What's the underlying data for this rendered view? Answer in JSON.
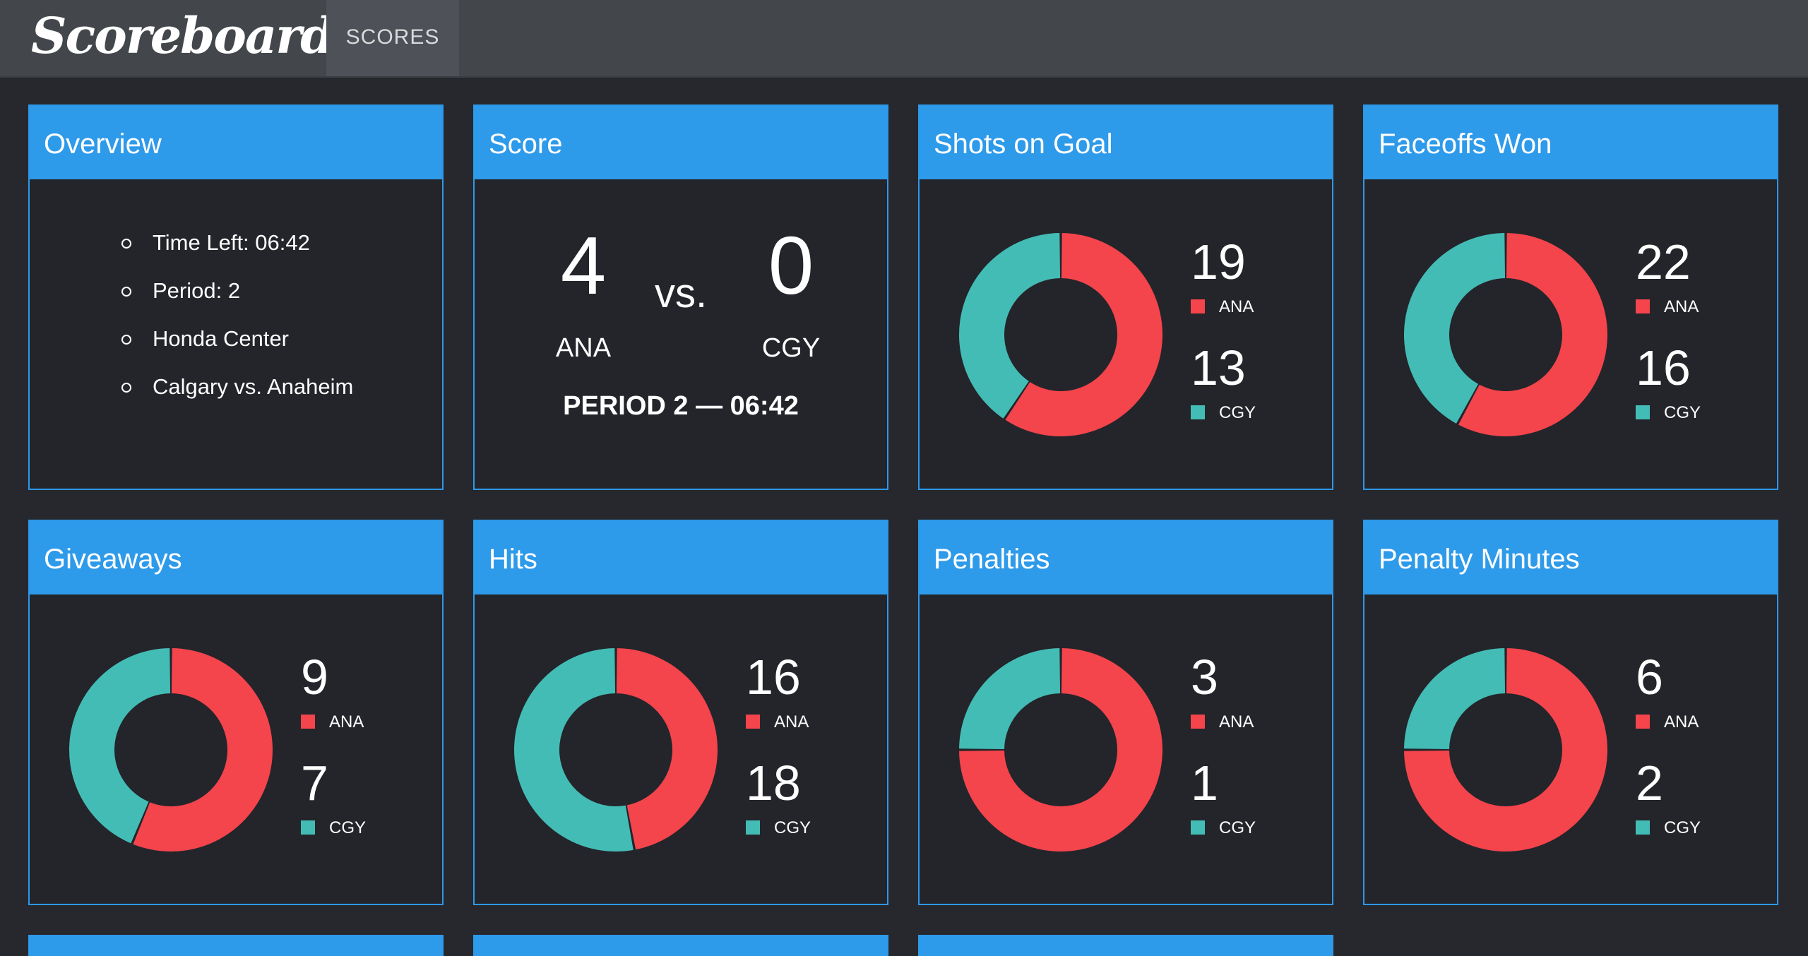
{
  "header": {
    "logo": "Scoreboard",
    "nav_tab": "SCORES"
  },
  "colors": {
    "ana": "#f4444c",
    "cgy": "#44bcb6",
    "panel_head": "#2e9aea",
    "background": "#26282d"
  },
  "overview": {
    "title": "Overview",
    "items": [
      "Time Left: 06:42",
      "Period: 2",
      "Honda Center",
      "Calgary vs. Anaheim"
    ]
  },
  "score": {
    "title": "Score",
    "home_score": "4",
    "home_team": "ANA",
    "vs": "vs.",
    "away_score": "0",
    "away_team": "CGY",
    "period_text": "PERIOD 2 — 06:42"
  },
  "stats": [
    {
      "title": "Shots on Goal",
      "ana_value": 19,
      "cgy_value": 13,
      "ana_label": "ANA",
      "cgy_label": "CGY"
    },
    {
      "title": "Faceoffs Won",
      "ana_value": 22,
      "cgy_value": 16,
      "ana_label": "ANA",
      "cgy_label": "CGY"
    },
    {
      "title": "Giveaways",
      "ana_value": 9,
      "cgy_value": 7,
      "ana_label": "ANA",
      "cgy_label": "CGY"
    },
    {
      "title": "Hits",
      "ana_value": 16,
      "cgy_value": 18,
      "ana_label": "ANA",
      "cgy_label": "CGY"
    },
    {
      "title": "Penalties",
      "ana_value": 3,
      "cgy_value": 1,
      "ana_label": "ANA",
      "cgy_label": "CGY"
    },
    {
      "title": "Penalty Minutes",
      "ana_value": 6,
      "cgy_value": 2,
      "ana_label": "ANA",
      "cgy_label": "CGY"
    }
  ],
  "chart_data": [
    {
      "type": "pie",
      "categories": [
        "ANA",
        "CGY"
      ],
      "values": [
        19,
        13
      ],
      "title": "Shots on Goal"
    },
    {
      "type": "pie",
      "categories": [
        "ANA",
        "CGY"
      ],
      "values": [
        22,
        16
      ],
      "title": "Faceoffs Won"
    },
    {
      "type": "pie",
      "categories": [
        "ANA",
        "CGY"
      ],
      "values": [
        9,
        7
      ],
      "title": "Giveaways"
    },
    {
      "type": "pie",
      "categories": [
        "ANA",
        "CGY"
      ],
      "values": [
        16,
        18
      ],
      "title": "Hits"
    },
    {
      "type": "pie",
      "categories": [
        "ANA",
        "CGY"
      ],
      "values": [
        3,
        1
      ],
      "title": "Penalties"
    },
    {
      "type": "pie",
      "categories": [
        "ANA",
        "CGY"
      ],
      "values": [
        6,
        2
      ],
      "title": "Penalty Minutes"
    }
  ]
}
